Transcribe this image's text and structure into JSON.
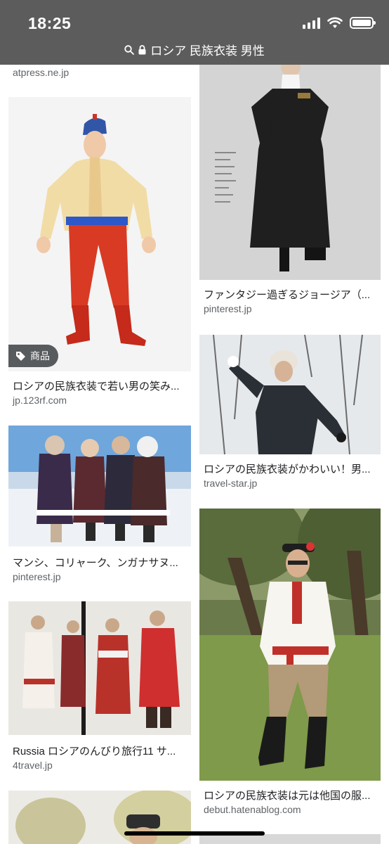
{
  "status": {
    "time": "18:25"
  },
  "browser": {
    "url_text": "ロシア 民族衣装 男性"
  },
  "top_source": "atpress.ne.jp",
  "left_cards": [
    {
      "title": "ロシアの民族衣装で若い男の笑み...",
      "source": "jp.123rf.com",
      "badge": "商品"
    },
    {
      "title": "マンシ、コリャーク、ンガナサヌ...",
      "source": "pinterest.jp"
    },
    {
      "title": "Russia ロシアのんびり旅行11 サ...",
      "source": "4travel.jp"
    }
  ],
  "right_cards": [
    {
      "title": "ファンタジー過ぎるジョージア（...",
      "source": "pinterest.jp"
    },
    {
      "title": "ロシアの民族衣装がかわいい！男...",
      "source": "travel-star.jp"
    },
    {
      "title": "ロシアの民族衣装は元は他国の服...",
      "source": "debut.hatenablog.com"
    }
  ],
  "colors": {
    "header_bg": "#5c5c5c",
    "source_gray": "#5f6368"
  }
}
